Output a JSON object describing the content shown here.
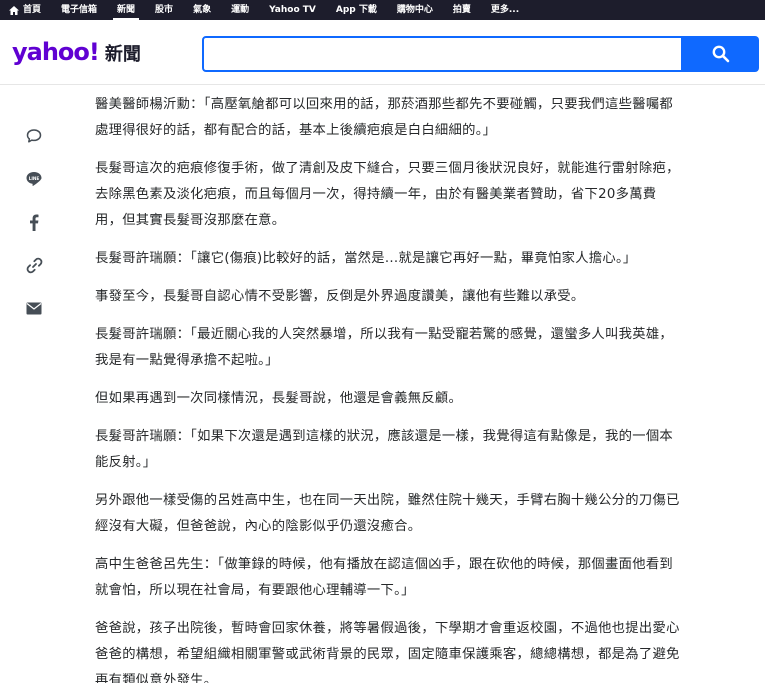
{
  "topnav": {
    "items": [
      {
        "label": "首頁"
      },
      {
        "label": "電子信箱"
      },
      {
        "label": "新聞"
      },
      {
        "label": "股市"
      },
      {
        "label": "氣象"
      },
      {
        "label": "運動"
      },
      {
        "label": "Yahoo TV"
      },
      {
        "label": "App 下載"
      },
      {
        "label": "購物中心"
      },
      {
        "label": "拍賣"
      },
      {
        "label": "更多..."
      }
    ],
    "active_index": 2,
    "bg_color": "#1d1d2c"
  },
  "header": {
    "logo_text": "yahoo!",
    "section_label": "新聞",
    "search_placeholder": "",
    "search_icon": "search-icon",
    "accent_color": "#0f69ff",
    "brand_color": "#6001d2"
  },
  "share": {
    "icons": [
      "comment-icon",
      "line-icon",
      "facebook-icon",
      "link-icon",
      "email-icon"
    ]
  },
  "article": {
    "paragraphs": [
      "醫美醫師楊沂勳：「高壓氧艙都可以回來用的話，那菸酒那些都先不要碰觸，只要我們這些醫囑都處理得很好的話，都有配合的話，基本上後續疤痕是白白細細的。」",
      "長髮哥這次的疤痕修復手術，做了清創及皮下縫合，只要三個月後狀況良好，就能進行雷射除疤，去除黑色素及淡化疤痕，而且每個月一次，得持續一年，由於有醫美業者贊助，省下20多萬費用，但其實長髮哥沒那麼在意。",
      "長髮哥許瑞願：「讓它(傷痕)比較好的話，當然是...就是讓它再好一點，畢竟怕家人擔心。」",
      "事發至今，長髮哥自認心情不受影響，反倒是外界過度讚美，讓他有些難以承受。",
      "長髮哥許瑞願：「最近關心我的人突然暴增，所以我有一點受寵若驚的感覺，還蠻多人叫我英雄，我是有一點覺得承擔不起啦。」",
      "但如果再遇到一次同樣情況，長髮哥說，他還是會義無反顧。",
      "長髮哥許瑞願：「如果下次還是遇到這樣的狀況，應該還是一樣，我覺得這有點像是，我的一個本能反射。」",
      "另外跟他一樣受傷的呂姓高中生，也在同一天出院，雖然住院十幾天，手臂右胸十幾公分的刀傷已經沒有大礙，但爸爸說，內心的陰影似乎仍還沒癒合。",
      "高中生爸爸呂先生：「做筆錄的時候，他有播放在認這個凶手，跟在砍他的時候，那個畫面他看到就會怕，所以現在社會局，有要跟他心理輔導一下。」",
      "爸爸說，孩子出院後，暫時會回家休養，將等暑假過後，下學期才會重返校園，不過他也提出愛心爸爸的構想，希望組織相關軍警或武術背景的民眾，固定隨車保護乘客，總總構想，都是為了避免再有類似意外發生。"
    ]
  }
}
